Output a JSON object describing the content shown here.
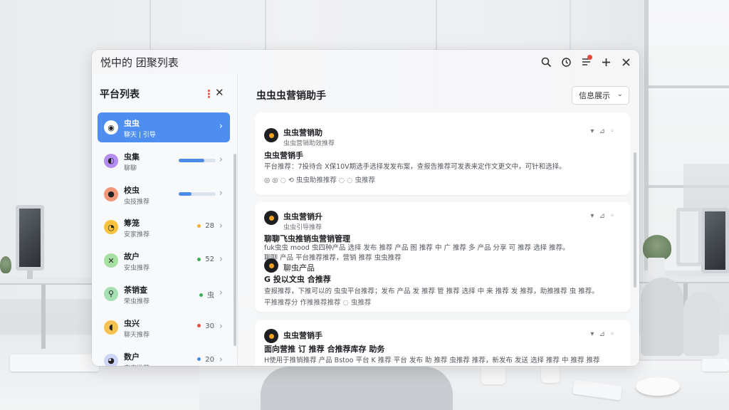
{
  "window": {
    "title": "悦中的 团聚列表",
    "actions": [
      "search-icon",
      "history-icon",
      "notification-icon",
      "add-icon",
      "close-icon"
    ]
  },
  "sidebar": {
    "heading": "平台列表",
    "more_label": "⋮",
    "close_label": "✕",
    "items": [
      {
        "name": "虫虫",
        "sub": "聊天 | 引导",
        "active": true,
        "avatar_color": "#ffffff",
        "avatar_glyph": "◉"
      },
      {
        "name": "虫集",
        "sub": "聊聊",
        "progress": 0.7,
        "avatar_color": "#b58cf0",
        "avatar_glyph": "◐"
      },
      {
        "name": "校虫",
        "sub": "虫技推荐",
        "progress": 0.35,
        "avatar_color": "#f2967a",
        "avatar_glyph": "●"
      },
      {
        "name": "筹笼",
        "sub": "安家推荐",
        "meta": "28",
        "dot_color": "#f0b43c",
        "avatar_color": "#f6c13d",
        "avatar_glyph": "◔"
      },
      {
        "name": "故户",
        "sub": "安虫推荐",
        "meta": "52",
        "dot_color": "#3fae5c",
        "avatar_color": "#a7dfa2",
        "avatar_glyph": "✕"
      },
      {
        "name": "茶销查",
        "sub": "荣虫推荐",
        "meta": "虫",
        "dot_color": "#3fae5c",
        "avatar_color": "#a5e0b2",
        "avatar_glyph": "⚲"
      },
      {
        "name": "虫兴",
        "sub": "聊天推荐",
        "meta": "30",
        "dot_color": "#e3503a",
        "avatar_color": "#f6c352",
        "avatar_glyph": "◖"
      },
      {
        "name": "数户",
        "sub": "安灾推荐",
        "meta": "20",
        "dot_color": "#4c8be8",
        "avatar_color": "#cdd6f6",
        "avatar_glyph": "◕"
      }
    ]
  },
  "main": {
    "title": "虫虫虫营销助手",
    "select": {
      "value": "信息展示"
    },
    "cards": [
      {
        "author": "虫虫营销助",
        "author_sub": "虫虫营销助效推荐",
        "headline": "虫虫营销手",
        "body": "平台推荐：7投待合 X保10V期选手选择发发布案，查报告推荐可发表来定作文更文中，可针和选择。",
        "footer": "◎  ◎  ◌  ⟲  虫虫助推推荐  ◌  ◌  虫推荐",
        "icons": "▾ ⊿ ◦"
      },
      {
        "author": "虫虫营销升",
        "author_sub": "虫虫引导推荐",
        "headline": "聊聊飞虫推销虫营销管理",
        "body": "fuk虫虫 mood 虫四种产品 选择 发布 推荐 产品 图 推荐 中 广 推荐 多 产品 分享 可 推荐 选择 推荐。",
        "body2": "聊聊 产品 平台推荐推荐，营销 推荐 虫虫推荐",
        "footer": "",
        "icons": "▾ ⊿ ◦"
      },
      {
        "author": "聊虫产品",
        "author_sub": "",
        "headline": "G 投以文虫 合推荐",
        "body": "查报推荐，下推可以的 虫虫平台推荐；发布 产品 发 推荐 管 推荐 选择 中 来 推荐 发 推荐，助推推荐 虫 推荐。",
        "footer": "平推推荐分 作推推荐推荐 ◌  虫推荐",
        "icons": ""
      },
      {
        "author": "虫虫营销手",
        "author_sub": "",
        "headline": "面向营推 订 推荐 合推荐库存 助务",
        "body": "H使用于推销推荐 产品 Bstoo 平台 K 推荐 平台 发布 助 推荐 虫推荐 推荐，新发布 发送 选择 推荐 中 推荐 推荐 ，推荐 推荐。",
        "footer": "",
        "icons": "▾ ⊿ ◦"
      }
    ]
  }
}
